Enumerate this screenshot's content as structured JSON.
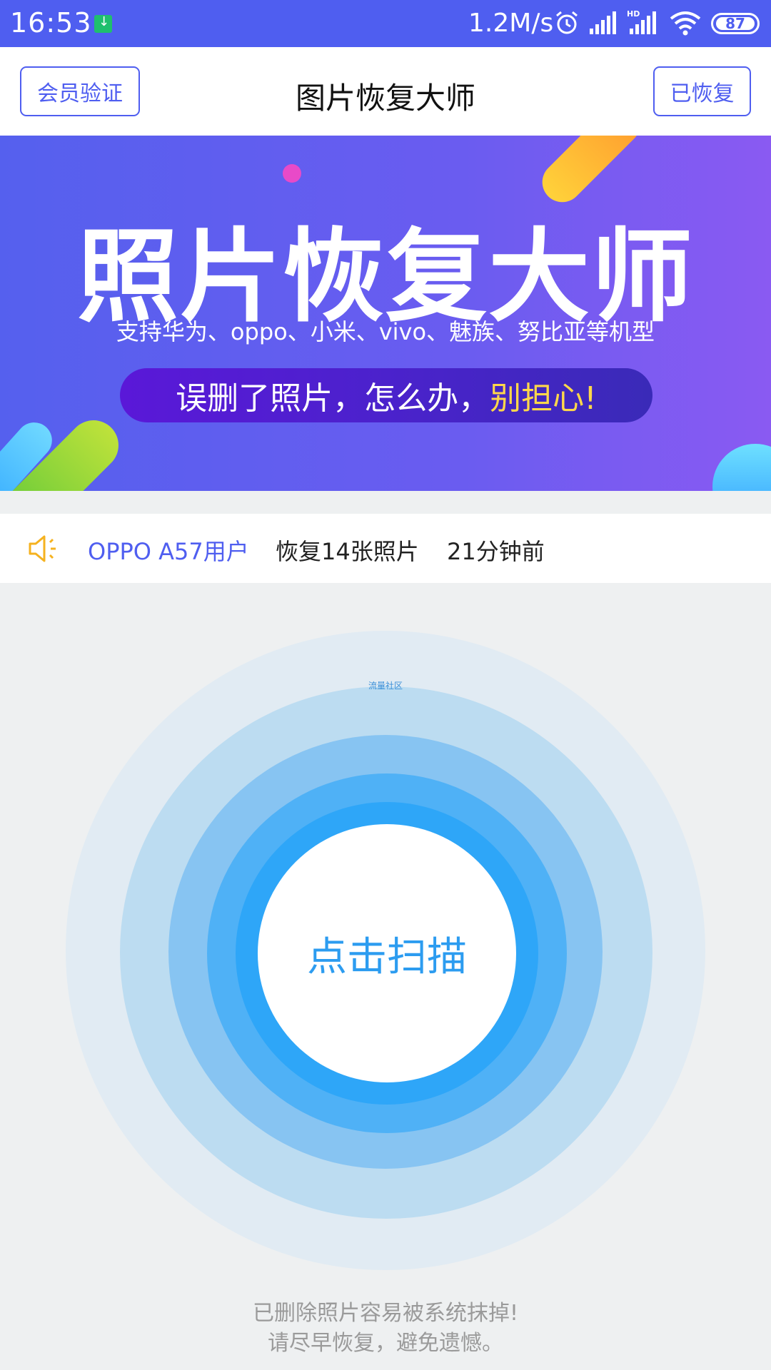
{
  "status_bar": {
    "time": "16:53",
    "net_speed": "1.2M/s",
    "battery": "87",
    "icons": [
      "download-icon",
      "alarm-icon",
      "signal-icon",
      "signal-hd-icon",
      "wifi-icon",
      "battery-icon"
    ],
    "bg_color": "#4f5ef0"
  },
  "header": {
    "left_button": "会员验证",
    "title": "图片恢复大师",
    "right_button": "已恢复"
  },
  "banner": {
    "title": "照片恢复大师",
    "subtitle": "支持华为、oppo、小米、vivo、魅族、努比亚等机型",
    "pill_text": "误删了照片，怎么办，",
    "pill_highlight": "别担心!"
  },
  "notice": {
    "icon": "speaker-icon",
    "user": "OPPO A57用户",
    "action": "恢复14张照片",
    "time": "21分钟前"
  },
  "scan": {
    "watermark": "流量社区",
    "button_label": "点击扫描"
  },
  "footer": {
    "line1": "已删除照片容易被系统抹掉!",
    "line2": "请尽早恢复，避免遗憾。"
  },
  "colors": {
    "accent": "#4f5ef0",
    "scan_blue": "#2ea6f8",
    "highlight_yellow": "#ffd84a"
  }
}
